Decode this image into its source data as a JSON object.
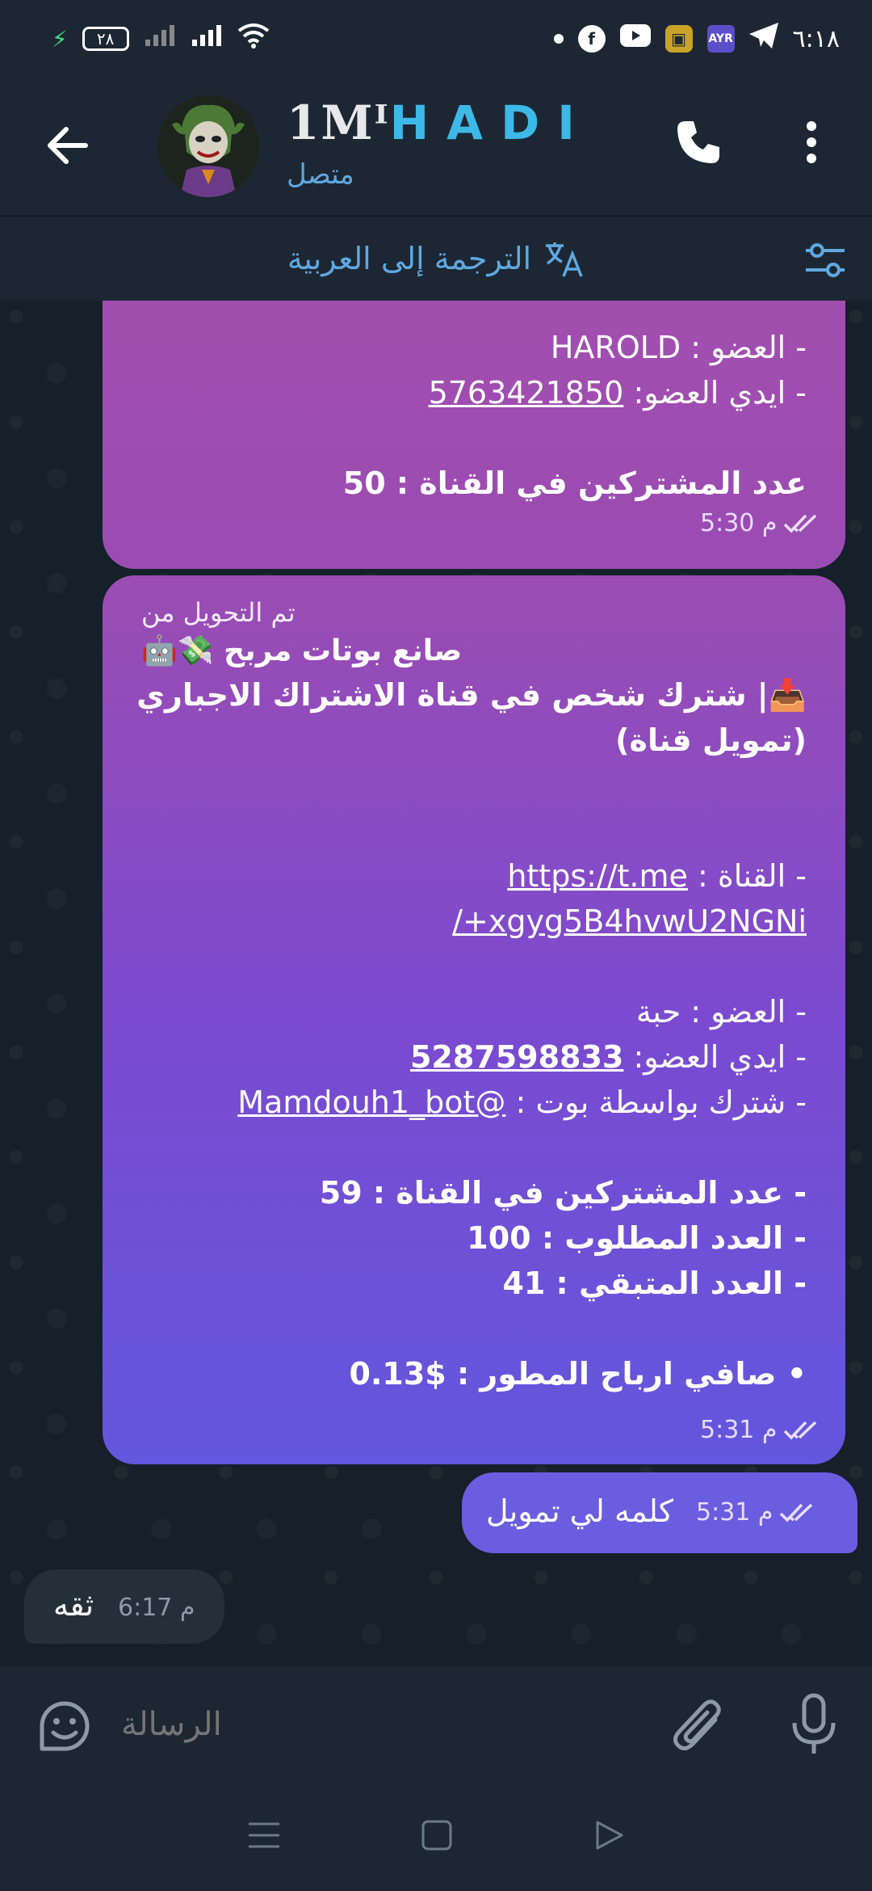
{
  "status_bar": {
    "time": "٦:١٨",
    "battery_level": "٢٨",
    "icons": [
      "charging-icon",
      "battery-icon",
      "signal-icon",
      "signal-icon",
      "wifi-icon",
      "dot-icon",
      "facebook-icon",
      "youtube-icon",
      "app-icon",
      "vpn-icon",
      "telegram-icon"
    ],
    "vpn_label": "AYR"
  },
  "header": {
    "name_prefix": "1M",
    "name_symbol": "ᴵ",
    "name": "HADI",
    "status": "متصل"
  },
  "translate_bar": {
    "label": "الترجمة إلى العربية"
  },
  "messages": [
    {
      "id": "msg1",
      "lines": [
        "- العضو : HAROLD",
        "- ايدي العضو:",
        "5763421850",
        "عدد المشتركين في القناة : 50"
      ],
      "time": "5:30 م"
    },
    {
      "id": "msg2",
      "forwarded_from_label": "تم التحويل من",
      "forwarded_from_name": "صانع بوتات مربح 💸🤖",
      "title_line1": "📥| شترك شخص في قناة الاشتراك الاجباري",
      "title_line2": "(تمويل قناة)",
      "channel_label": "- القناة :",
      "channel_link_part1": "https://t.me",
      "channel_link_part2": "/+xgyg5B4hvwU2NGNi",
      "member_line": "- العضو : حبة",
      "member_id_label": "- ايدي العضو:",
      "member_id": "5287598833",
      "bot_label": "- شترك بواسطة بوت :",
      "bot_link": "@Mamdouh1_bot",
      "subscribers": "- عدد المشتركين في القناة : 59",
      "required": "- العدد المطلوب : 100",
      "remaining": "- العدد المتبقي : 41",
      "profit": "• صافي ارباح المطور : $0.13",
      "time": "5:31 م"
    },
    {
      "id": "msg3",
      "text": "كلمه لي تمويل",
      "time": "5:31 م"
    },
    {
      "id": "msg4",
      "text": "ثقه",
      "time": "6:17 م"
    }
  ],
  "input": {
    "placeholder": "الرسالة"
  },
  "colors": {
    "accent": "#3db9e8",
    "header_bg": "#1d2733",
    "chat_bg": "#15202a",
    "bubble_purple_top": "#a24eae",
    "bubble_blue": "#6a5de0"
  }
}
